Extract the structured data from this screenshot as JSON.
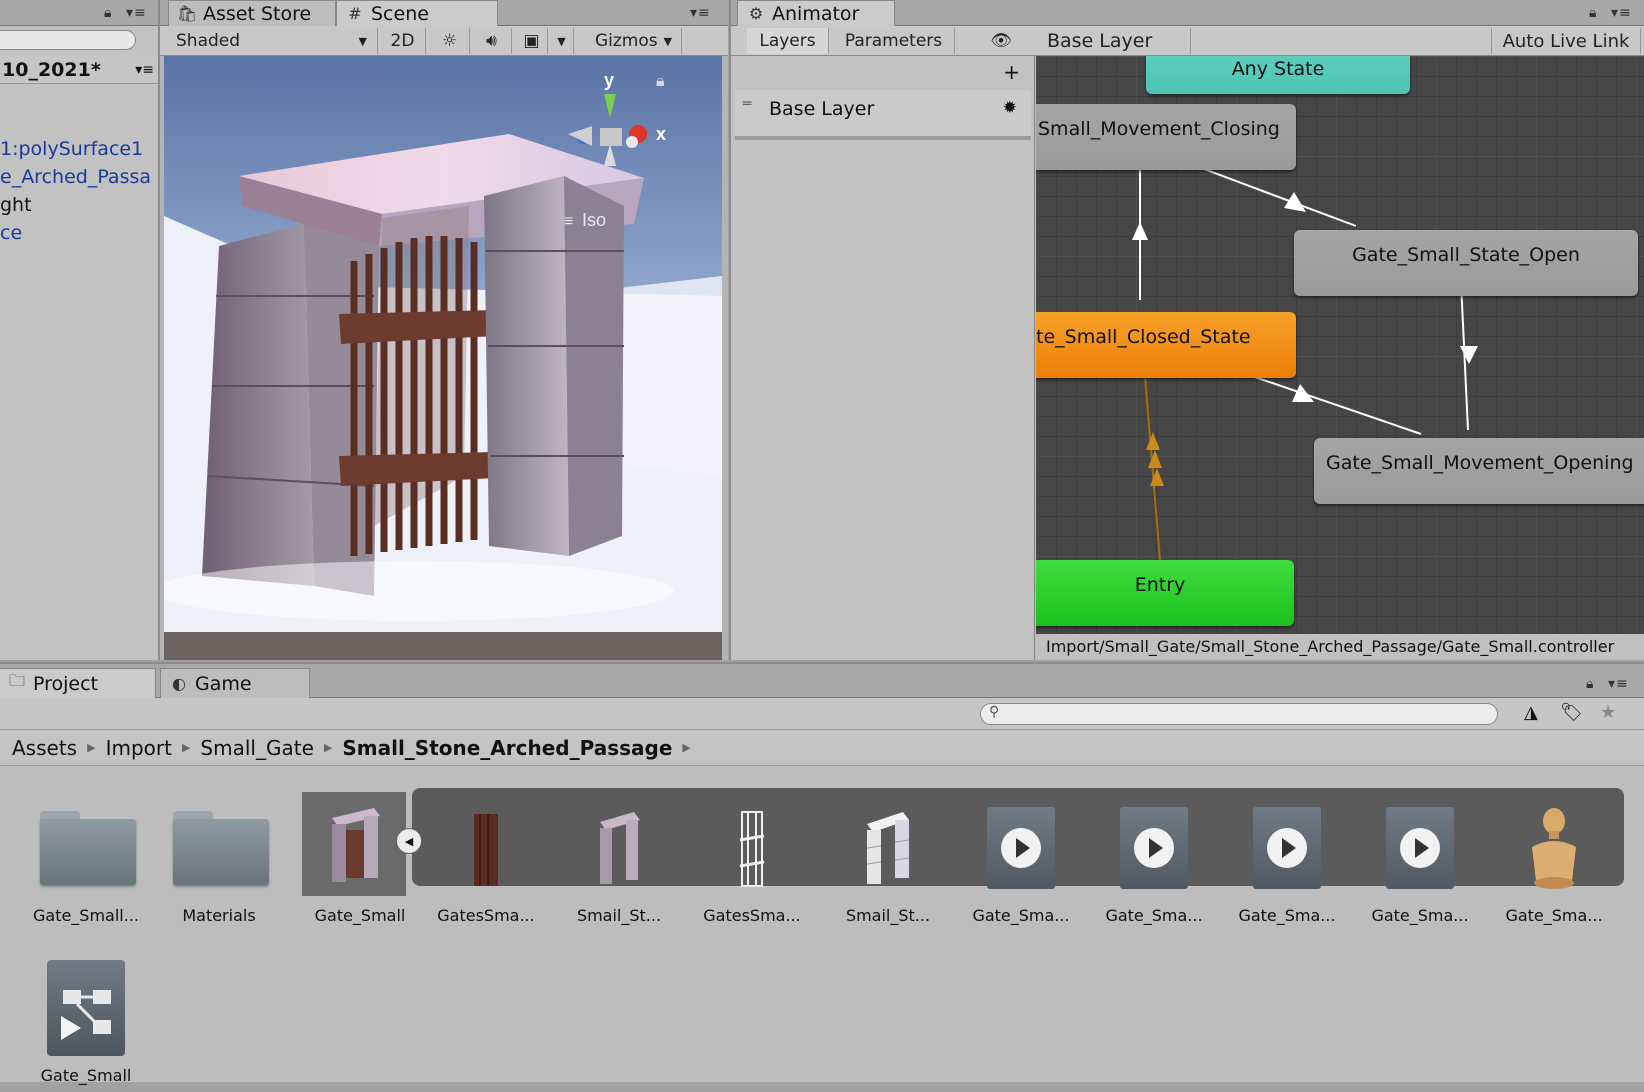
{
  "hierarchy": {
    "scene_name": "10_2021*",
    "items": [
      "1:polySurface1",
      "e_Arched_Passa",
      "ght",
      "ce"
    ]
  },
  "scene_panel": {
    "tabs": [
      "Asset Store",
      "Scene"
    ],
    "shading_mode": "Shaded",
    "mode_2d": "2D",
    "gizmos_label": "Gizmos",
    "axis_y": "y",
    "axis_x": "x",
    "projection": "Iso"
  },
  "animator": {
    "tab": "Animator",
    "subtabs": [
      "Layers",
      "Parameters"
    ],
    "layer_breadcrumb": "Base Layer",
    "auto_live_link": "Auto Live Link",
    "add_symbol": "+",
    "layers": [
      {
        "name": "Base Layer"
      }
    ],
    "states": {
      "any_state": "Any State",
      "closing": "Small_Movement_Closing",
      "open": "Gate_Small_State_Open",
      "closed": "te_Small_Closed_State",
      "opening": "Gate_Small_Movement_Opening",
      "entry": "Entry"
    },
    "controller_path": "Import/Small_Gate/Small_Stone_Arched_Passage/Gate_Small.controller"
  },
  "project": {
    "tabs": [
      "Project",
      "Game"
    ],
    "breadcrumb": [
      "Assets",
      "Import",
      "Small_Gate",
      "Small_Stone_Arched_Passage"
    ],
    "assets": [
      {
        "label": "Gate_Small...",
        "kind": "folder"
      },
      {
        "label": "Materials",
        "kind": "folder"
      },
      {
        "label": "Gate_Small",
        "kind": "model-selected"
      },
      {
        "label": "GatesSma...",
        "kind": "mesh-gate"
      },
      {
        "label": "Smail_St...",
        "kind": "mesh-arch"
      },
      {
        "label": "GatesSma...",
        "kind": "mesh-gate-wire"
      },
      {
        "label": "Smail_St...",
        "kind": "mesh-arch-wire"
      },
      {
        "label": "Gate_Sma...",
        "kind": "anim-clip"
      },
      {
        "label": "Gate_Sma...",
        "kind": "anim-clip"
      },
      {
        "label": "Gate_Sma...",
        "kind": "anim-clip"
      },
      {
        "label": "Gate_Sma...",
        "kind": "anim-clip"
      },
      {
        "label": "Gate_Sma...",
        "kind": "avatar"
      },
      {
        "label": "Gate_Small",
        "kind": "animator-controller"
      }
    ]
  }
}
